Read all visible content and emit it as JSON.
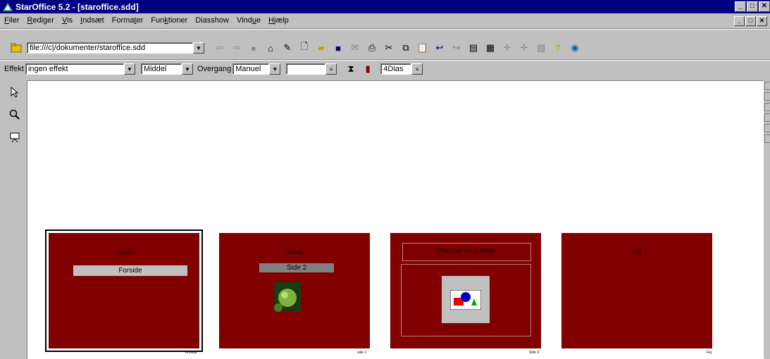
{
  "window": {
    "title": "StarOffice 5.2 - [staroffice.sdd]",
    "buttons": [
      "_",
      "□",
      "✕"
    ]
  },
  "menu": [
    {
      "label": "Filer",
      "u": "F"
    },
    {
      "label": "Rediger",
      "u": "R"
    },
    {
      "label": "Vis",
      "u": "V"
    },
    {
      "label": "Indsæt",
      "u": "I"
    },
    {
      "label": "Formater",
      "u": "t"
    },
    {
      "label": "Funktioner",
      "u": "k"
    },
    {
      "label": "Diasshow",
      "u": ""
    },
    {
      "label": "Vindue",
      "u": "u"
    },
    {
      "label": "Hjælp",
      "u": "H"
    }
  ],
  "url_bar": {
    "value": "file:///c|/dokumenter/staroffice.sdd"
  },
  "function_icons": [
    "back-icon",
    "forward-icon",
    "stop-icon",
    "home-icon",
    "edit-file-icon",
    "new-icon",
    "open-icon",
    "save-icon",
    "mail-icon",
    "print-icon",
    "cut-icon",
    "copy-icon",
    "paste-icon",
    "undo-icon",
    "redo-icon",
    "navigator-icon",
    "stylist-icon",
    "insert-icon",
    "draw-icon",
    "gallery-icon",
    "help-icon",
    "globe-icon"
  ],
  "object_bar": {
    "effect_label": "Effekt",
    "effect_value": "ingen effekt",
    "speed_value": "Middel",
    "transition_label": "Overgang",
    "transition_value": "Manuel",
    "time_value": "",
    "slides_value": "4Dias"
  },
  "slides": [
    {
      "title": "Forside",
      "bar_text": "Forside",
      "caption": "Forside",
      "selected": true
    },
    {
      "title": "edfend",
      "bar_text": "Side 2",
      "caption": "side 1",
      "selected": false
    },
    {
      "title": "Tilføj titel ved at klikke",
      "bar_text": "",
      "caption": "Side 3",
      "selected": false
    },
    {
      "title": "Fej",
      "bar_text": "",
      "caption": "Fej",
      "selected": false
    }
  ],
  "colors": {
    "titlebar": "#000080",
    "slide_bg": "#800000",
    "chrome": "#c0c0c0"
  }
}
